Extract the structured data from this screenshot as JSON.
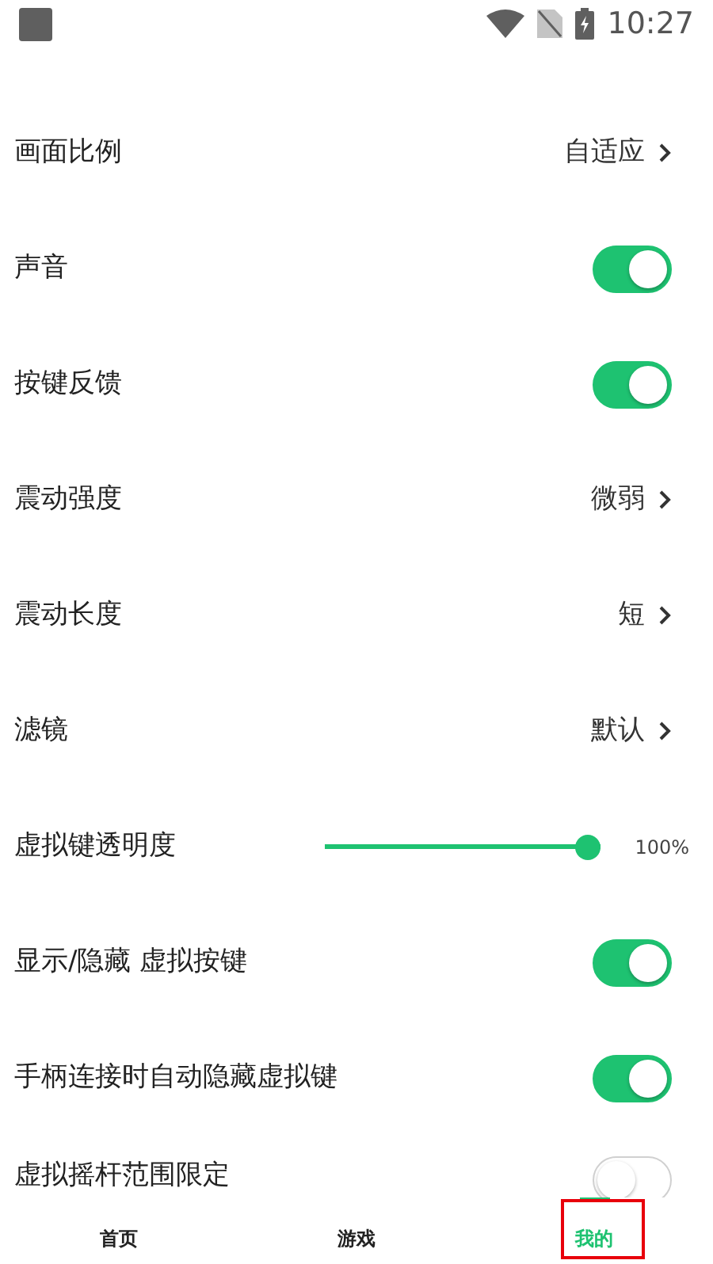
{
  "status_bar": {
    "time": "10:27"
  },
  "settings": [
    {
      "kind": "choice",
      "label": "画面比例",
      "value": "自适应"
    },
    {
      "kind": "toggle",
      "label": "声音",
      "on": true
    },
    {
      "kind": "toggle",
      "label": "按键反馈",
      "on": true
    },
    {
      "kind": "choice",
      "label": "震动强度",
      "value": "微弱"
    },
    {
      "kind": "choice",
      "label": "震动长度",
      "value": "短"
    },
    {
      "kind": "choice",
      "label": "滤镜",
      "value": "默认"
    },
    {
      "kind": "slider",
      "label": "虚拟键透明度",
      "level": 1,
      "reading": "100%"
    },
    {
      "kind": "toggle",
      "label": "显示/隐藏 虚拟按键",
      "on": true
    },
    {
      "kind": "toggle",
      "label": "手柄连接时自动隐藏虚拟键",
      "on": true
    },
    {
      "kind": "toggle",
      "label": "虚拟摇杆范围限定",
      "on": false
    }
  ],
  "bottom_nav": [
    {
      "label": "首页",
      "selected": false,
      "highlighted": false
    },
    {
      "label": "游戏",
      "selected": false,
      "highlighted": false
    },
    {
      "label": "我的",
      "selected": true,
      "highlighted": true
    }
  ]
}
